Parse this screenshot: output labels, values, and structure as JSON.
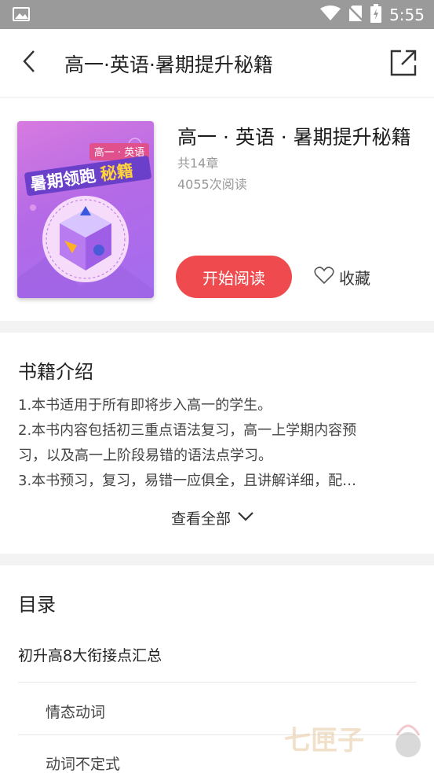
{
  "status_bar": {
    "time": "5:55",
    "icons": [
      "image-icon",
      "wifi-icon",
      "no-sim-icon",
      "battery-icon"
    ]
  },
  "app_bar": {
    "title": "高一·英语·暑期提升秘籍",
    "icons": [
      "back-arrow-icon",
      "share-icon"
    ]
  },
  "book": {
    "title": "高一 · 英语 · 暑期提升秘籍",
    "chapters": "共14章",
    "reads": "4055次阅读",
    "cover": {
      "tag": "高一 · 英语",
      "headline_main": "暑期领跑",
      "headline_accent": "秘籍"
    },
    "read_button": "开始阅读",
    "favorite_label": "收藏"
  },
  "intro": {
    "heading": "书籍介绍",
    "lines": [
      "1.本书适用于所有即将步入高一的学生。",
      "2.本书内容包括初三重点语法复习，高一上学期内容预",
      "习，以及高一上阶段易错的语法点学习。",
      "3.本书预习，复习，易错一应俱全，且讲解详细，配…"
    ],
    "view_all": "查看全部"
  },
  "toc": {
    "heading": "目录",
    "chapter": "初升高8大衔接点汇总",
    "items": [
      "情态动词",
      "动词不定式"
    ]
  },
  "watermark": "七匣子",
  "colors": {
    "accent": "#ef4b4f",
    "status_bar": "#9a9a9a",
    "section_gap": "#f3f3f3"
  }
}
